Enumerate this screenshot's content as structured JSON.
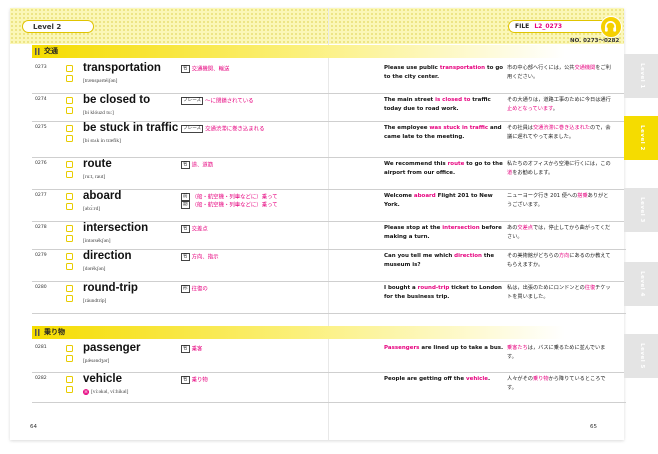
{
  "header": {
    "level_label": "Level 2",
    "file_label": "FILE",
    "file_number": "L2_0273",
    "range": "NO. 0273〜0282"
  },
  "sections": [
    {
      "title": "交通"
    },
    {
      "title": "乗り物"
    }
  ],
  "entries": [
    {
      "no": "0273",
      "word": "transportation",
      "pron": "[trӕnspərtéiʃən]",
      "meanings": [
        {
          "pos": "名",
          "text": "交通機関、輸送"
        }
      ],
      "ex": [
        {
          "t": "Please use public ",
          "h": false
        },
        {
          "t": "transportation",
          "h": true
        },
        {
          "t": " to go to the city center.",
          "h": false
        }
      ],
      "jp": [
        {
          "t": "市の中心部へ行くには，公共",
          "h": false
        },
        {
          "t": "交通機関",
          "h": true
        },
        {
          "t": "をご利用ください。",
          "h": false
        }
      ]
    },
    {
      "no": "0274",
      "word": "be closed to",
      "pron": "[bi klóuzd tu:]",
      "meanings": [
        {
          "pos": "フレーズ",
          "text": "〜に閉鎖されている"
        }
      ],
      "ex": [
        {
          "t": "The main street ",
          "h": false
        },
        {
          "t": "is closed to",
          "h": true
        },
        {
          "t": " traffic today due to road work.",
          "h": false
        }
      ],
      "jp": [
        {
          "t": "その大通りは，道路工事のために今日は通行",
          "h": false
        },
        {
          "t": "止めとなっています",
          "h": true
        },
        {
          "t": "。",
          "h": false
        }
      ]
    },
    {
      "no": "0275",
      "word": "be stuck in traffic",
      "pron": "[bi stʌk in trӕfik]",
      "meanings": [
        {
          "pos": "フレーズ",
          "text": "交通渋滞に巻き込まれる"
        }
      ],
      "ex": [
        {
          "t": "The employee ",
          "h": false
        },
        {
          "t": "was stuck in traffic",
          "h": true
        },
        {
          "t": " and came late to the meeting.",
          "h": false
        }
      ],
      "jp": [
        {
          "t": "その社員は",
          "h": false
        },
        {
          "t": "交通渋滞に巻き込まれた",
          "h": true
        },
        {
          "t": "ので，会議に遅れてやって来ました。",
          "h": false
        }
      ]
    },
    {
      "no": "0276",
      "word": "route",
      "pron": "[ru:t, raut]",
      "meanings": [
        {
          "pos": "名",
          "text": "道、道筋"
        }
      ],
      "ex": [
        {
          "t": "We recommend this ",
          "h": false
        },
        {
          "t": "route",
          "h": true
        },
        {
          "t": " to go to the airport from our office.",
          "h": false
        }
      ],
      "jp": [
        {
          "t": "私たちのオフィスから空港に行くには，この",
          "h": false
        },
        {
          "t": "道",
          "h": true
        },
        {
          "t": "をお勧めします。",
          "h": false
        }
      ]
    },
    {
      "no": "0277",
      "word": "aboard",
      "pron": "[əbɔ́:rd]",
      "meanings": [
        {
          "pos": "前",
          "text": "（船・航空機・列車などに）乗って"
        },
        {
          "pos": "副",
          "text": "（船・航空機・列車などに）乗って"
        }
      ],
      "ex": [
        {
          "t": "Welcome ",
          "h": false
        },
        {
          "t": "aboard",
          "h": true
        },
        {
          "t": " Flight 201 to New York.",
          "h": false
        }
      ],
      "jp": [
        {
          "t": "ニューヨーク行き 201 便への",
          "h": false
        },
        {
          "t": "搭乗",
          "h": true
        },
        {
          "t": "ありがとうございます。",
          "h": false
        }
      ]
    },
    {
      "no": "0278",
      "word": "intersection",
      "pron": "[intərsékʃən]",
      "meanings": [
        {
          "pos": "名",
          "text": "交差点"
        }
      ],
      "ex": [
        {
          "t": "Please stop at the ",
          "h": false
        },
        {
          "t": "intersection",
          "h": true
        },
        {
          "t": " before making a turn.",
          "h": false
        }
      ],
      "jp": [
        {
          "t": "あの",
          "h": false
        },
        {
          "t": "交差点",
          "h": true
        },
        {
          "t": "では，停止してから曲がってください。",
          "h": false
        }
      ]
    },
    {
      "no": "0279",
      "word": "direction",
      "pron": "[dərékʃən]",
      "meanings": [
        {
          "pos": "名",
          "text": "方向、指示"
        }
      ],
      "ex": [
        {
          "t": "Can you tell me which ",
          "h": false
        },
        {
          "t": "direction",
          "h": true
        },
        {
          "t": " the museum is?",
          "h": false
        }
      ],
      "jp": [
        {
          "t": "その美術館がどちらの",
          "h": false
        },
        {
          "t": "方向",
          "h": true
        },
        {
          "t": "にあるのか教えてもらえますか。",
          "h": false
        }
      ]
    },
    {
      "no": "0280",
      "word": "round-trip",
      "pron": "[ráundtríp]",
      "meanings": [
        {
          "pos": "形",
          "text": "往復の"
        }
      ],
      "ex": [
        {
          "t": "I bought a ",
          "h": false
        },
        {
          "t": "round-trip",
          "h": true
        },
        {
          "t": " ticket to London for the business trip.",
          "h": false
        }
      ],
      "jp": [
        {
          "t": "私は，出張のためにロンドンとの",
          "h": false
        },
        {
          "t": "往復",
          "h": true
        },
        {
          "t": "チケットを買いました。",
          "h": false
        }
      ]
    },
    {
      "no": "0281",
      "word": "passenger",
      "pron": "[pǽsəndʒər]",
      "meanings": [
        {
          "pos": "名",
          "text": "乗客"
        }
      ],
      "ex": [
        {
          "t": "Passengers",
          "h": true
        },
        {
          "t": " are lined up to take a bus.",
          "h": false
        }
      ],
      "jp": [
        {
          "t": "乗客たち",
          "h": true
        },
        {
          "t": "は，バスに乗るために並んでいます。",
          "h": false
        }
      ]
    },
    {
      "no": "0282",
      "word": "vehicle",
      "pron": "[ví:əkəl, ví:hikəl]",
      "pron_mark": "米",
      "meanings": [
        {
          "pos": "名",
          "text": "乗り物"
        }
      ],
      "ex": [
        {
          "t": "People are getting off the ",
          "h": false
        },
        {
          "t": "vehicle",
          "h": true
        },
        {
          "t": ".",
          "h": false
        }
      ],
      "jp": [
        {
          "t": "人々がその",
          "h": false
        },
        {
          "t": "乗り物",
          "h": true
        },
        {
          "t": "から降りているところです。",
          "h": false
        }
      ]
    }
  ],
  "tabs": [
    {
      "label": "Level 1",
      "active": false
    },
    {
      "label": "Level 2",
      "active": true
    },
    {
      "label": "Level 3",
      "active": false
    },
    {
      "label": "Level 4",
      "active": false
    },
    {
      "label": "Level 5",
      "active": false
    }
  ],
  "page_numbers": {
    "left": "64",
    "right": "65"
  },
  "colors": {
    "accent": "#f5dc00",
    "highlight": "#e6007e"
  }
}
